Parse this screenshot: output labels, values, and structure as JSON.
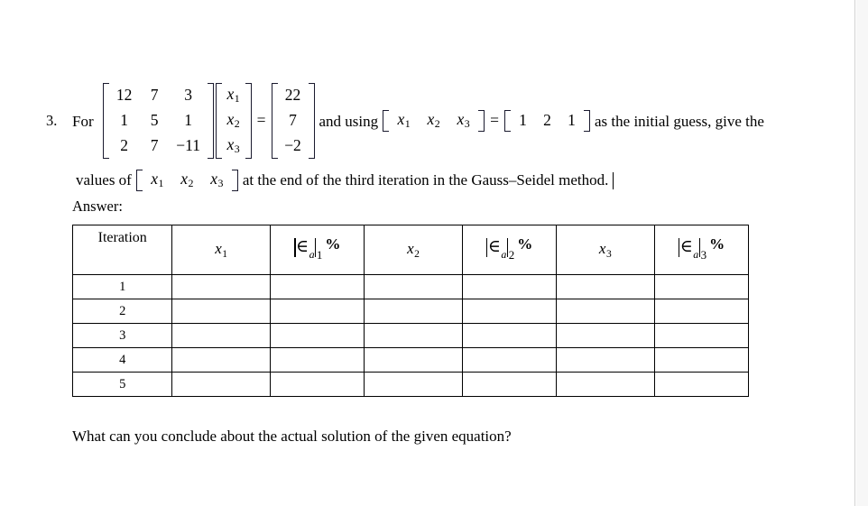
{
  "document": {
    "item_number": "3.",
    "lead_word": "For",
    "coefficient_matrix": [
      [
        "12",
        "7",
        "3"
      ],
      [
        "1",
        "5",
        "1"
      ],
      [
        "2",
        "7",
        "−11"
      ]
    ],
    "unknown_vector": [
      {
        "base": "x",
        "sub": "1"
      },
      {
        "base": "x",
        "sub": "2"
      },
      {
        "base": "x",
        "sub": "3"
      }
    ],
    "equals_sign": "=",
    "rhs_vector": [
      "22",
      "7",
      "−2"
    ],
    "text_after_equation": "and using",
    "initial_guess_vector": [
      {
        "base": "x",
        "sub": "1"
      },
      {
        "base": "x",
        "sub": "2"
      },
      {
        "base": "x",
        "sub": "3"
      }
    ],
    "initial_guess_values": [
      "1",
      "2",
      "1"
    ],
    "text_after_guess": "as the initial guess, give the",
    "line2_prefix": "values of",
    "line2_vector": [
      {
        "base": "x",
        "sub": "1"
      },
      {
        "base": "x",
        "sub": "2"
      },
      {
        "base": "x",
        "sub": "3"
      }
    ],
    "line2_suffix": "at the end of the third iteration in the Gauss–Seidel method.",
    "answer_label": "Answer:",
    "closing_question": "What can you conclude about the actual solution of the given equation?"
  },
  "table": {
    "headers": {
      "iteration": "Iteration",
      "x1": {
        "base": "x",
        "sub": "1"
      },
      "e1": {
        "glyph": "∈",
        "a": "a",
        "index": "1",
        "percent": "%"
      },
      "x2": {
        "base": "x",
        "sub": "2"
      },
      "e2": {
        "glyph": "∈",
        "a": "a",
        "index": "2",
        "percent": "%"
      },
      "x3": {
        "base": "x",
        "sub": "3"
      },
      "e3": {
        "glyph": "∈",
        "a": "a",
        "index": "3",
        "percent": "%"
      }
    },
    "rows": [
      {
        "iteration": "1",
        "x1": "",
        "e1": "",
        "x2": "",
        "e2": "",
        "x3": "",
        "e3": ""
      },
      {
        "iteration": "2",
        "x1": "",
        "e1": "",
        "x2": "",
        "e2": "",
        "x3": "",
        "e3": ""
      },
      {
        "iteration": "3",
        "x1": "",
        "e1": "",
        "x2": "",
        "e2": "",
        "x3": "",
        "e3": ""
      },
      {
        "iteration": "4",
        "x1": "",
        "e1": "",
        "x2": "",
        "e2": "",
        "x3": "",
        "e3": ""
      },
      {
        "iteration": "5",
        "x1": "",
        "e1": "",
        "x2": "",
        "e2": "",
        "x3": "",
        "e3": ""
      }
    ]
  },
  "colors": {
    "text": "#000000",
    "bracket": "#1a1a2e",
    "table_border": "#000000",
    "page_background": "#ffffff",
    "gutter": "#f7f7f7"
  }
}
